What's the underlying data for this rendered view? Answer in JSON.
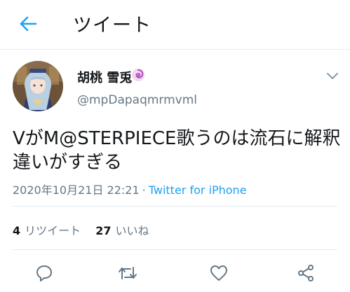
{
  "header": {
    "back_icon": "arrow-left-icon",
    "title": "ツイート"
  },
  "tweet": {
    "author": {
      "display_name": "胡桃 雪兎",
      "name_emoji": "cyclone-emoji",
      "handle": "@mpDapaqmrmvml"
    },
    "text": "VがM@STERPIECE歌うのは流石に解釈違いがすぎる",
    "timestamp": "2020年10月21日 22:21",
    "separator": "·",
    "source": "Twitter for iPhone",
    "stats": {
      "retweets_count": "4",
      "retweets_label": "リツイート",
      "likes_count": "27",
      "likes_label": "いいね"
    }
  },
  "actions": {
    "reply_icon": "reply-icon",
    "retweet_icon": "retweet-icon",
    "like_icon": "heart-icon",
    "share_icon": "share-icon"
  },
  "colors": {
    "accent": "#1da1f2",
    "text": "#14171a",
    "secondary": "#657786",
    "divider": "#e6ecf0"
  }
}
